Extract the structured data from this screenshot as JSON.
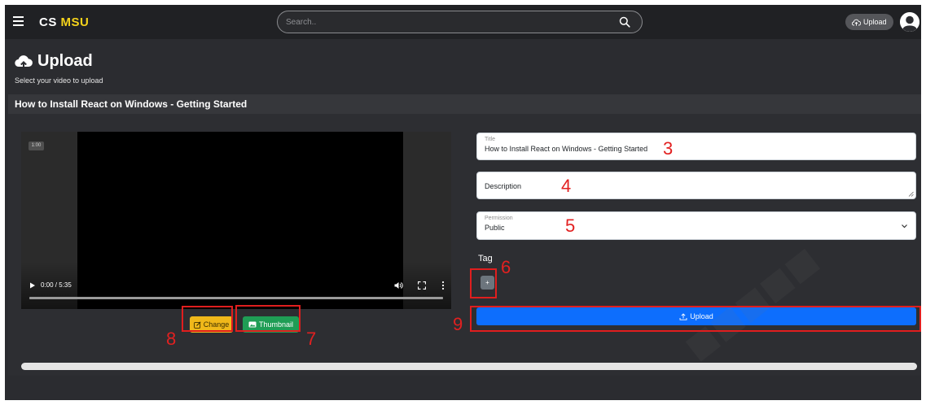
{
  "navbar": {
    "brand_primary": "CS",
    "brand_accent": "MSU",
    "search_placeholder": "Search..",
    "upload_label": "Upload"
  },
  "header": {
    "title": "Upload",
    "subtitle": "Select your video to upload"
  },
  "video": {
    "heading": "How to Install React on Windows - Getting Started",
    "time_badge": "1:00",
    "time_display": "0:00 / 5:35",
    "progress": 0
  },
  "actions": {
    "change_label": "Change",
    "thumbnail_label": "Thumbnail"
  },
  "form": {
    "title_label": "Title",
    "title_value": "How to Install React on Windows - Getting Started",
    "description_placeholder": "Description",
    "permission_label": "Permission",
    "permission_value": "Public",
    "tag_label": "Tag",
    "tag_add_label": "+",
    "upload_label": "Upload"
  },
  "annotations": {
    "title": "3",
    "description": "4",
    "permission": "5",
    "tag": "6",
    "thumbnail": "7",
    "change": "8",
    "upload": "9"
  },
  "colors": {
    "brand_accent": "#f5d31b",
    "change_button": "#f0b81a",
    "thumbnail_button": "#1f9d55",
    "upload_button": "#0d6efd",
    "annotation": "#e01e1e"
  }
}
